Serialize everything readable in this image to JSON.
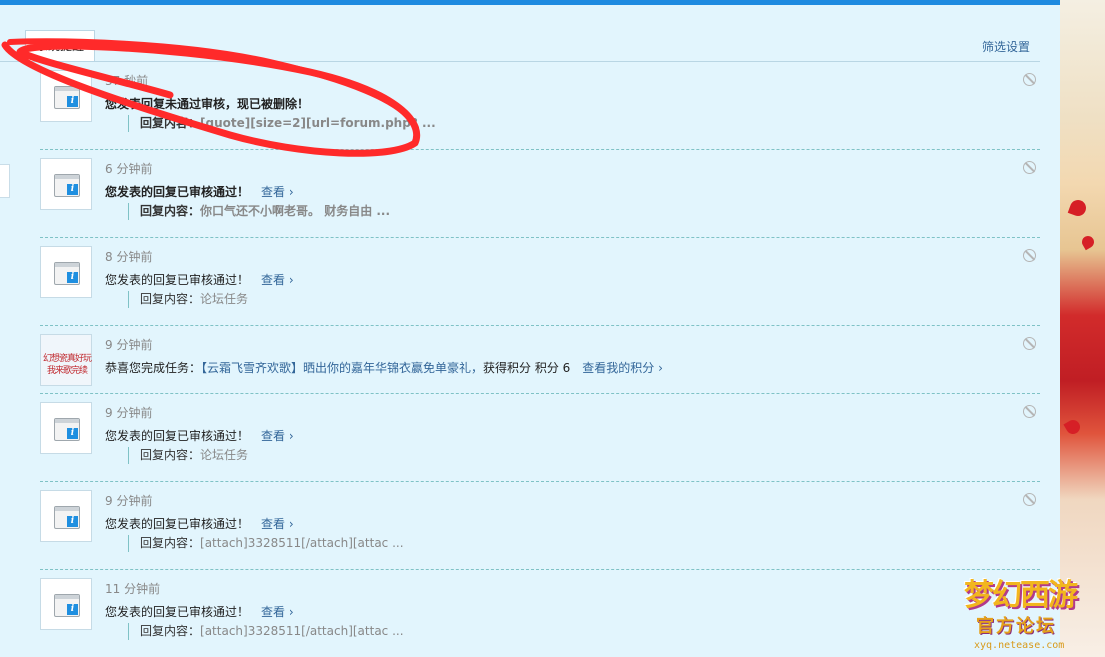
{
  "tab_label": "系统提醒",
  "filter_link": "筛选设置",
  "view_label": "查看 ›",
  "quote_label": "回复内容：",
  "notices": [
    {
      "time": "37 秒前",
      "message": "您发表回复未通过审核，现已被删除！",
      "quote": "[quote][size=2][url=forum.php? ..."
    },
    {
      "time": "6 分钟前",
      "message": "您发表的回复已审核通过！",
      "quote": "你口气还不小啊老哥。 财务自由 ..."
    },
    {
      "time": "8 分钟前",
      "message": "您发表的回复已审核通过！",
      "quote": "论坛任务"
    },
    {
      "time": "9 分钟前",
      "message_prefix": "恭喜您完成任务：",
      "task_name": "【云霜飞雪齐欢歌】晒出你的嘉年华锦衣赢免单豪礼，",
      "reward": "获得积分 积分 6",
      "points_link": "查看我的积分 ›",
      "avatar_text": [
        "幻想瓷真好玩",
        "我来歌完续"
      ]
    },
    {
      "time": "9 分钟前",
      "message": "您发表的回复已审核通过！",
      "quote": "论坛任务"
    },
    {
      "time": "9 分钟前",
      "message": "您发表的回复已审核通过！",
      "quote": "[attach]3328511[/attach][attac ..."
    },
    {
      "time": "11 分钟前",
      "message": "您发表的回复已审核通过！",
      "quote": "[attach]3328511[/attach][attac ..."
    }
  ],
  "watermark": {
    "title": "梦幻西游",
    "subtitle": "官方论坛",
    "url": "xyq.netease.com"
  },
  "colors": {
    "accent": "#1e8ae0",
    "link": "#336699",
    "background": "#e2f5fd",
    "separator": "#7fc2c6",
    "annotation": "#ff2a2a"
  }
}
